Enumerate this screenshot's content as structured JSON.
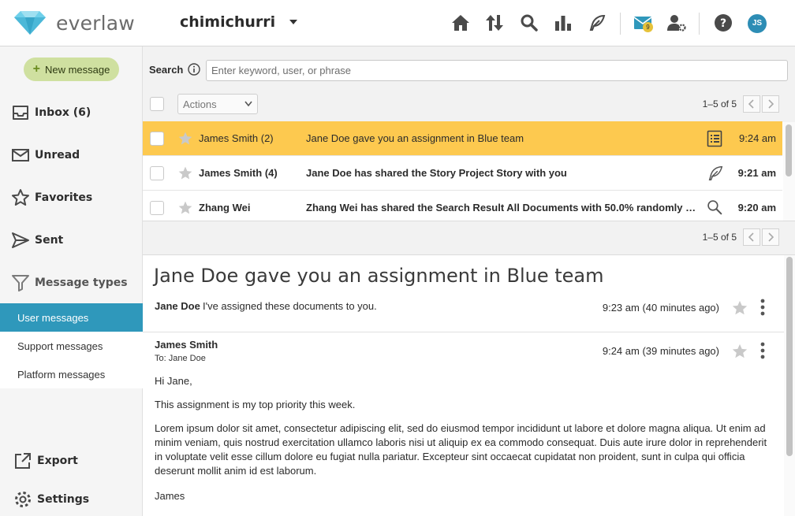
{
  "header": {
    "logo_text": "everlaw",
    "project_name": "chimichurri",
    "mail_badge": "9",
    "avatar_initials": "JS",
    "icons": [
      "home-icon",
      "upload-download-icon",
      "search-icon",
      "analytics-icon",
      "storybuilder-feather-icon",
      "messages-icon",
      "project-admin-icon",
      "help-icon"
    ]
  },
  "sidebar": {
    "new_message": "New message",
    "nav": [
      {
        "label": "Inbox (6)",
        "icon": "inbox-icon"
      },
      {
        "label": "Unread",
        "icon": "envelope-icon"
      },
      {
        "label": "Favorites",
        "icon": "star-outline-icon"
      },
      {
        "label": "Sent",
        "icon": "send-icon"
      },
      {
        "label": "Message types",
        "icon": "filter-icon"
      }
    ],
    "types": [
      {
        "label": "User messages",
        "active": true
      },
      {
        "label": "Support messages",
        "active": false
      },
      {
        "label": "Platform messages",
        "active": false
      }
    ],
    "export": "Export",
    "settings": "Settings"
  },
  "search": {
    "label": "Search",
    "placeholder": "Enter keyword, user, or phrase",
    "value": ""
  },
  "toolbar": {
    "actions_label": "Actions",
    "pager_text": "1–5 of 5"
  },
  "messages": [
    {
      "sender": "James Smith (2)",
      "subject": "Jane Doe gave you an assignment in Blue team",
      "type_icon": "assignment-list-icon",
      "time": "9:24 am",
      "selected": true,
      "unread": false
    },
    {
      "sender": "James Smith (4)",
      "subject": "Jane Doe has shared the Story Project Story with you",
      "type_icon": "storybuilder-feather-icon",
      "time": "9:21 am",
      "selected": false,
      "unread": true
    },
    {
      "sender": "Zhang Wei",
      "subject": "Zhang Wei has shared the Search Result All Documents with 50.0% randomly sa...",
      "type_icon": "search-icon",
      "time": "9:20 am",
      "selected": false,
      "unread": true
    }
  ],
  "bottom_pager": "1–5 of 5",
  "reader": {
    "title": "Jane Doe gave you an assignment in Blue team",
    "message1": {
      "sender": "Jane Doe",
      "preview": "I've assigned these documents to you.",
      "time": "9:23 am (40 minutes ago)"
    },
    "message2": {
      "sender": "James Smith",
      "to": "To: Jane Doe",
      "time": "9:24 am (39 minutes ago)",
      "greeting": "Hi Jane,",
      "line1": "This assignment is my top priority this week.",
      "paragraph": "Lorem ipsum dolor sit amet, consectetur adipiscing elit, sed do eiusmod tempor incididunt ut labore et dolore magna aliqua. Ut enim ad minim veniam, quis nostrud exercitation ullamco laboris nisi ut aliquip ex ea commodo consequat. Duis aute irure dolor in reprehenderit in voluptate velit esse cillum dolore eu fugiat nulla pariatur. Excepteur sint occaecat cupidatat non proident, sunt in culpa qui officia deserunt mollit anim id est laborum.",
      "signoff": "James"
    }
  },
  "colors": {
    "accent": "#2f98bb",
    "selected_row": "#fdc94f",
    "new_message_bg": "#cfe0a0",
    "logo_blue": "#5ec5e0"
  }
}
